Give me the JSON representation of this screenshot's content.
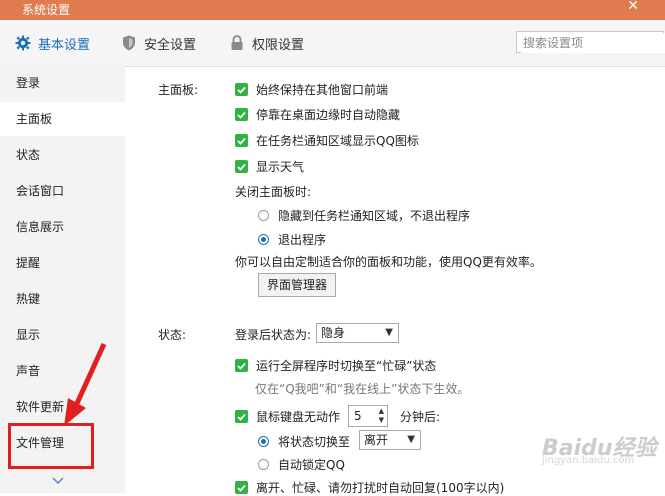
{
  "window": {
    "title": "系统设置"
  },
  "tabs": [
    {
      "label": "基本设置",
      "icon": "gear-icon"
    },
    {
      "label": "安全设置",
      "icon": "shield-icon"
    },
    {
      "label": "权限设置",
      "icon": "lock-icon"
    }
  ],
  "search": {
    "placeholder": "搜索设置项"
  },
  "sidebar": {
    "items": [
      "登录",
      "主面板",
      "状态",
      "会话窗口",
      "信息展示",
      "提醒",
      "热键",
      "显示",
      "声音",
      "软件更新",
      "文件管理"
    ],
    "active": "主面板",
    "more_icon": "chevron-down-icon"
  },
  "main_panel": {
    "section_label": "主面板:",
    "options": [
      "始终保持在其他窗口前端",
      "停靠在桌面边缘时自动隐藏",
      "在任务栏通知区域显示QQ图标",
      "显示天气"
    ],
    "close_label": "关闭主面板时:",
    "close_options": [
      "隐藏到任务栏通知区域，不退出程序",
      "退出程序"
    ],
    "close_selected": "退出程序",
    "custom_hint": "你可以自由定制适合你的面板和功能，使用QQ更有效率。",
    "manager_button": "界面管理器"
  },
  "status": {
    "section_label": "状态:",
    "login_status_label": "登录后状态为:",
    "login_status_value": "隐身",
    "fullscreen_busy": "运行全屏程序时切换至“忙碌”状态",
    "fullscreen_hint": "仅在“Q我吧”和“我在线上”状态下生效。",
    "idle_prefix": "鼠标键盘无动作",
    "idle_minutes": "5",
    "idle_suffix": "分钟后:",
    "switch_label": "将状态切换至",
    "switch_value": "离开",
    "autolock_label": "自动锁定QQ",
    "auto_reply": "离开、忙碌、请勿打扰时自动回复(100字以内)"
  },
  "colors": {
    "accent": "#1e6fb8",
    "titlebar": "#e07a4f",
    "check": "#2fb344",
    "highlight": "#e02020"
  },
  "watermark": {
    "logo": "Baidu经验",
    "url": "jingyan.baidu.com"
  }
}
